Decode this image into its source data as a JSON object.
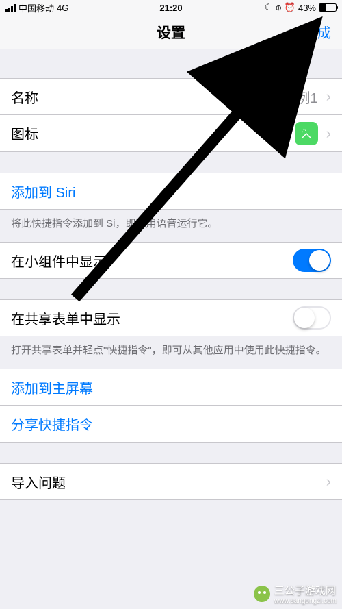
{
  "status": {
    "carrier": "中国移动",
    "network": "4G",
    "time": "21:20",
    "battery_pct": "43%"
  },
  "nav": {
    "title": "设置",
    "done": "完成"
  },
  "rows": {
    "name_label": "名称",
    "name_value": "案例1",
    "icon_label": "图标",
    "siri_label": "添加到 Siri",
    "siri_note_a": "将此快捷指令添加到 Si",
    "siri_note_b": "，即可用语音运行它。",
    "widget_label": "在小组件中显示",
    "share_sheet_label": "在共享表单中显示",
    "share_sheet_note": "打开共享表单并轻点\"快捷指令\"，即可从其他应用中使用此快捷指令。",
    "add_home_label": "添加到主屏幕",
    "share_shortcut_label": "分享快捷指令",
    "import_q_label": "导入问题"
  },
  "toggles": {
    "widget": true,
    "share_sheet": false
  },
  "watermark": {
    "text": "三公子游戏网",
    "url": "www.sangongzi.com"
  }
}
